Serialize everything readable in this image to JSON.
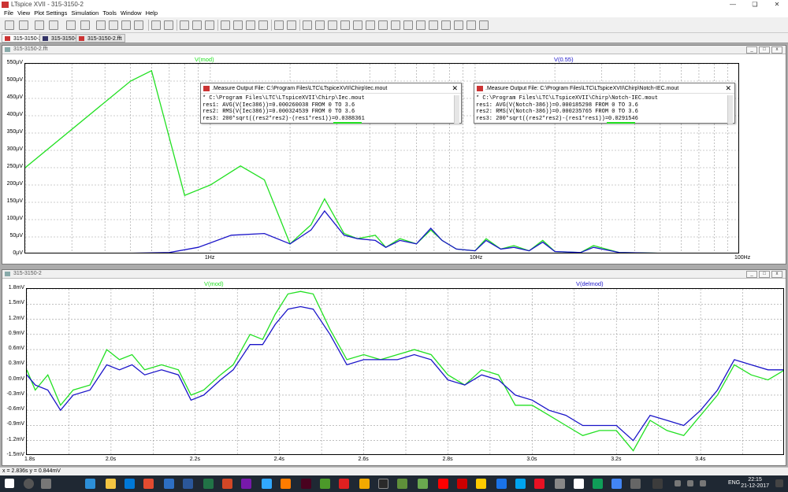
{
  "window": {
    "title": "LTspice XVII - 315-3150-2"
  },
  "menu": [
    "File",
    "View",
    "Plot Settings",
    "Simulation",
    "Tools",
    "Window",
    "Help"
  ],
  "tabs": [
    {
      "label": "315-3150-2",
      "active": true
    },
    {
      "label": "315-3150-2",
      "active": false
    },
    {
      "label": "315-3150-2.fft",
      "active": false
    }
  ],
  "top_plot": {
    "window_title": "315-3150-2.fft",
    "trace1_label": "V(mod)",
    "trace2_label": "V(0.55)",
    "y_ticks": [
      "550µV",
      "500µV",
      "450µV",
      "400µV",
      "350µV",
      "300µV",
      "250µV",
      "200µV",
      "150µV",
      "100µV",
      "50µV",
      "0µV"
    ],
    "x_ticks": [
      "1Hz",
      "10Hz",
      "100Hz"
    ]
  },
  "bottom_plot": {
    "window_title": "315-3150-2",
    "trace1_label": "V(mod)",
    "trace2_label": "V(delmod)",
    "y_ticks": [
      "1.8mV",
      "1.5mV",
      "1.2mV",
      "0.9mV",
      "0.6mV",
      "0.3mV",
      "0.0mV",
      "-0.3mV",
      "-0.6mV",
      "-0.9mV",
      "-1.2mV",
      "-1.5mV"
    ],
    "x_ticks": [
      "1.8s",
      "2.0s",
      "2.2s",
      "2.4s",
      "2.6s",
      "2.8s",
      "3.0s",
      "3.2s",
      "3.4s"
    ]
  },
  "measure1": {
    "title": ".Measure Output File: C:\\Program Files\\LTC\\LTspiceXVII\\Chirp\\Iec.mout",
    "lines": [
      "* C:\\Program Files\\LTC\\LTspiceXVII\\Chirp\\Iec.mout",
      "res1: AVG(V(Iec386))=0.000260038 FROM 0 TO 3.6",
      "res2: RMS(V(Iec386))=0.000324539 FROM 0 TO 3.6",
      "res3: 200*sqrt((res2*res2)-(res1*res1))=0.0388361"
    ]
  },
  "measure2": {
    "title": ".Measure Output File: C:\\Program Files\\LTC\\LTspiceXVII\\Chirp\\Notch-IEC.mout",
    "lines": [
      "* C:\\Program Files\\LTC\\LTspiceXVII\\Chirp\\Notch-IEC.mout",
      "res1: AVG(V(Notch-386))=0.000185298 FROM 0 TO 3.6",
      "res2: RMS(V(Notch-386))=0.000235765 FROM 0 TO 3.6",
      "res3: 200*sqrt((res2*res2)-(res1*res1))=0.0291546"
    ]
  },
  "status": {
    "text": "x = 2.836s    y = 0.844mV"
  },
  "clock": {
    "time": "22:15",
    "date": "21-12-2017",
    "lang": "ENG"
  },
  "colors": {
    "green": "#22e022",
    "blue": "#1a14c8",
    "grid": "#9a9a9a"
  },
  "chart_data": [
    {
      "type": "line",
      "xlabel": "",
      "ylabel": "",
      "x_scale": "log",
      "xlim": [
        0.2,
        100
      ],
      "ylim": [
        0,
        550
      ],
      "grid": true,
      "series": [
        {
          "name": "V(mod)",
          "x": [
            0.2,
            0.5,
            0.6,
            0.8,
            1.0,
            1.3,
            1.6,
            2.0,
            2.4,
            2.7,
            3.2,
            3.6,
            4.2,
            4.6,
            5.2,
            6.0,
            6.8,
            7.5,
            8.5,
            10,
            11,
            12.5,
            14,
            16,
            18,
            20,
            25,
            28,
            35,
            50,
            70,
            100
          ],
          "values": [
            250,
            500,
            530,
            170,
            200,
            255,
            215,
            30,
            85,
            160,
            60,
            45,
            55,
            20,
            45,
            30,
            70,
            40,
            15,
            10,
            45,
            15,
            25,
            10,
            40,
            8,
            5,
            25,
            5,
            3,
            2,
            1
          ]
        },
        {
          "name": "V(0.55)",
          "x": [
            0.2,
            0.5,
            0.7,
            0.9,
            1.2,
            1.6,
            2.0,
            2.4,
            2.7,
            3.2,
            3.6,
            4.2,
            4.6,
            5.2,
            6.0,
            6.8,
            7.5,
            8.5,
            10,
            11,
            12.5,
            14,
            16,
            18,
            20,
            25,
            28,
            35,
            50,
            70,
            100
          ],
          "values": [
            2,
            3,
            5,
            20,
            55,
            60,
            30,
            70,
            125,
            55,
            45,
            40,
            20,
            40,
            30,
            75,
            40,
            15,
            10,
            40,
            15,
            20,
            10,
            35,
            8,
            5,
            20,
            5,
            3,
            2,
            1
          ]
        }
      ]
    },
    {
      "type": "line",
      "xlabel": "",
      "ylabel": "",
      "xlim": [
        1.8,
        3.6
      ],
      "ylim": [
        -1.5,
        1.8
      ],
      "grid": true,
      "series": [
        {
          "name": "V(mod)",
          "x": [
            1.8,
            1.82,
            1.85,
            1.88,
            1.91,
            1.95,
            1.99,
            2.02,
            2.05,
            2.08,
            2.12,
            2.16,
            2.19,
            2.22,
            2.26,
            2.29,
            2.33,
            2.36,
            2.39,
            2.42,
            2.45,
            2.48,
            2.52,
            2.56,
            2.6,
            2.64,
            2.68,
            2.72,
            2.76,
            2.8,
            2.84,
            2.88,
            2.92,
            2.96,
            3.0,
            3.04,
            3.08,
            3.12,
            3.16,
            3.2,
            3.24,
            3.28,
            3.32,
            3.36,
            3.4,
            3.44,
            3.48,
            3.52,
            3.56,
            3.6
          ],
          "values": [
            0.2,
            -0.2,
            0.1,
            -0.5,
            -0.2,
            -0.1,
            0.6,
            0.4,
            0.5,
            0.2,
            0.3,
            0.2,
            -0.3,
            -0.2,
            0.1,
            0.3,
            0.9,
            0.8,
            1.3,
            1.7,
            1.75,
            1.7,
            1.0,
            0.4,
            0.5,
            0.4,
            0.5,
            0.6,
            0.5,
            0.1,
            -0.1,
            0.2,
            0.1,
            -0.5,
            -0.5,
            -0.7,
            -0.9,
            -1.1,
            -1.0,
            -1.0,
            -1.4,
            -0.8,
            -1.0,
            -1.1,
            -0.7,
            -0.3,
            0.3,
            0.1,
            0.0,
            0.2
          ]
        },
        {
          "name": "V(delmod)",
          "x": [
            1.8,
            1.82,
            1.85,
            1.88,
            1.91,
            1.95,
            1.99,
            2.02,
            2.05,
            2.08,
            2.12,
            2.16,
            2.19,
            2.22,
            2.26,
            2.29,
            2.33,
            2.36,
            2.39,
            2.42,
            2.45,
            2.48,
            2.52,
            2.56,
            2.6,
            2.64,
            2.68,
            2.72,
            2.76,
            2.8,
            2.84,
            2.88,
            2.92,
            2.96,
            3.0,
            3.04,
            3.08,
            3.12,
            3.16,
            3.2,
            3.24,
            3.28,
            3.32,
            3.36,
            3.4,
            3.44,
            3.48,
            3.52,
            3.56,
            3.6
          ],
          "values": [
            0.1,
            -0.1,
            -0.2,
            -0.6,
            -0.3,
            -0.2,
            0.3,
            0.2,
            0.3,
            0.1,
            0.2,
            0.1,
            -0.4,
            -0.3,
            0.0,
            0.2,
            0.7,
            0.7,
            1.1,
            1.4,
            1.45,
            1.4,
            0.9,
            0.3,
            0.4,
            0.4,
            0.4,
            0.5,
            0.4,
            0.0,
            -0.1,
            0.1,
            0.0,
            -0.3,
            -0.4,
            -0.6,
            -0.7,
            -0.9,
            -0.9,
            -0.9,
            -1.2,
            -0.7,
            -0.8,
            -0.9,
            -0.6,
            -0.2,
            0.4,
            0.3,
            0.2,
            0.2
          ]
        }
      ]
    }
  ]
}
